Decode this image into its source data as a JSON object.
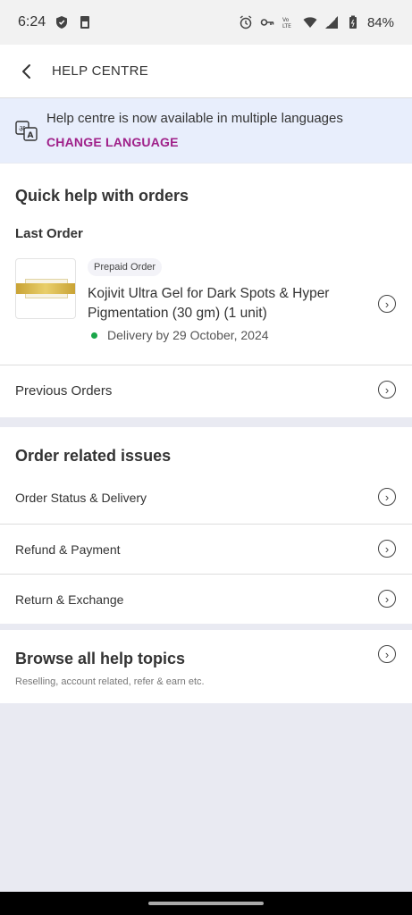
{
  "status_bar": {
    "time": "6:24",
    "battery": "84%",
    "icons": [
      "shield-icon",
      "sim-icon",
      "alarm-icon",
      "key-icon",
      "volte-icon",
      "wifi-icon",
      "signal-icon",
      "battery-icon"
    ]
  },
  "app_bar": {
    "title": "HELP CENTRE"
  },
  "language_banner": {
    "message": "Help centre is now available in multiple languages",
    "cta": "CHANGE LANGUAGE"
  },
  "quick_help": {
    "heading": "Quick help with orders",
    "last_order_label": "Last Order",
    "order": {
      "badge": "Prepaid Order",
      "product_name": "Kojivit Ultra Gel for Dark Spots & Hyper Pigmentation (30 gm) (1 unit)",
      "delivery": "Delivery by 29 October, 2024"
    },
    "previous_orders_label": "Previous Orders"
  },
  "order_issues": {
    "heading": "Order related issues",
    "items": [
      {
        "label": "Order Status & Delivery"
      },
      {
        "label": "Refund & Payment"
      },
      {
        "label": "Return & Exchange"
      }
    ]
  },
  "browse": {
    "heading": "Browse all help topics",
    "subtitle": "Reselling, account related, refer & earn etc."
  },
  "colors": {
    "accent": "#9f2089",
    "banner_bg": "#e8eefc",
    "page_bg": "#e9eaf2",
    "delivery_dot": "#1aa64a"
  }
}
